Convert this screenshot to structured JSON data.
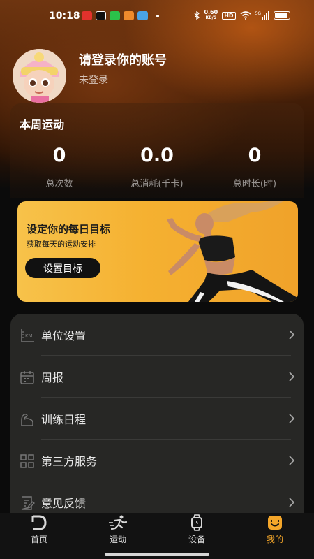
{
  "status_bar": {
    "time": "10:18",
    "net_speed": "0.60",
    "net_unit": "KB/S",
    "hd": "HD",
    "signal": "5G"
  },
  "profile": {
    "title": "请登录你的账号",
    "status": "未登录"
  },
  "weekly": {
    "title": "本周运动",
    "stats": [
      {
        "value": "0",
        "label": "总次数"
      },
      {
        "value": "0.0",
        "label": "总消耗(千卡)"
      },
      {
        "value": "0",
        "label": "总时长(时)"
      }
    ]
  },
  "goal_banner": {
    "title": "设定你的每日目标",
    "subtitle": "获取每天的运动安排",
    "button": "设置目标"
  },
  "menu": {
    "items": [
      {
        "label": "单位设置",
        "icon": "ruler-km-icon"
      },
      {
        "label": "周报",
        "icon": "calendar-icon"
      },
      {
        "label": "训练日程",
        "icon": "muscle-arm-icon"
      },
      {
        "label": "第三方服务",
        "icon": "grid-icon"
      },
      {
        "label": "意见反馈",
        "icon": "feedback-icon"
      }
    ]
  },
  "tabbar": {
    "tabs": [
      {
        "label": "首页",
        "icon": "home-d-icon"
      },
      {
        "label": "运动",
        "icon": "runner-icon"
      },
      {
        "label": "设备",
        "icon": "watch-icon"
      },
      {
        "label": "我的",
        "icon": "profile-face-icon"
      }
    ],
    "active_index": 3
  },
  "colors": {
    "accent": "#f4a62a",
    "banner": "#f5b131",
    "card": "#272725"
  }
}
